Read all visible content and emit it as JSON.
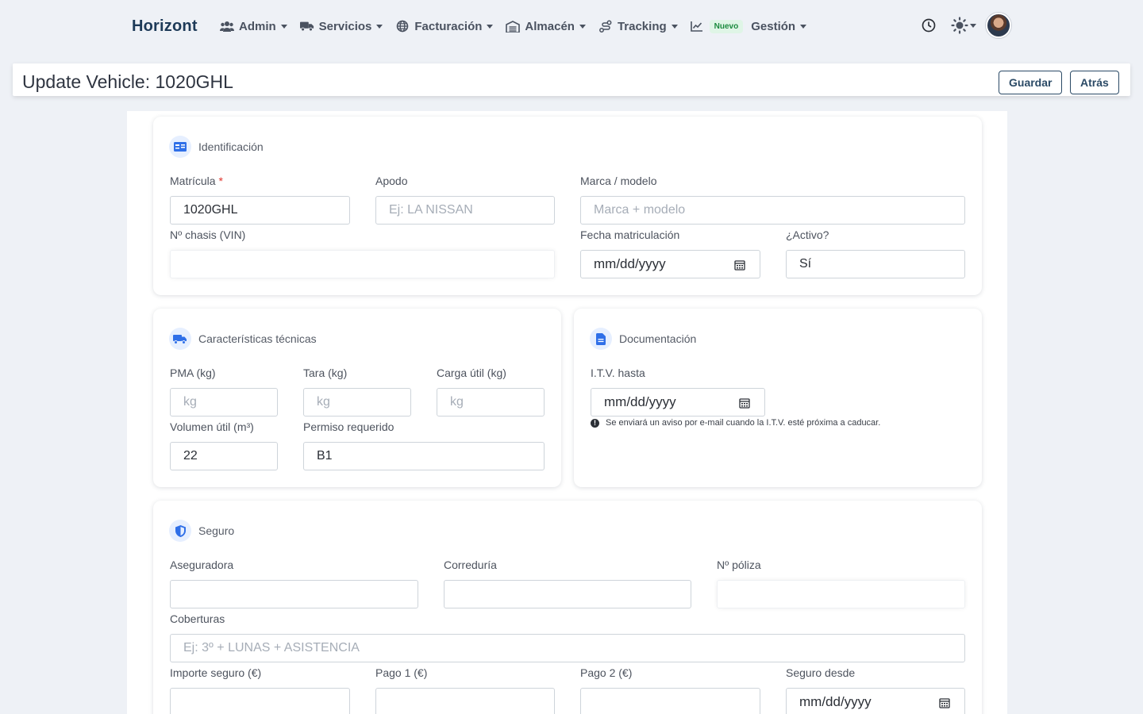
{
  "nav": {
    "brand": "Horizont",
    "items": [
      {
        "label": "Admin",
        "icon": "users-icon"
      },
      {
        "label": "Servicios",
        "icon": "truck-icon"
      },
      {
        "label": "Facturación",
        "icon": "globe-icon"
      },
      {
        "label": "Almacén",
        "icon": "warehouse-icon"
      },
      {
        "label": "Tracking",
        "icon": "route-icon"
      }
    ],
    "badge": "Nuevo",
    "gestion": "Gestión"
  },
  "header": {
    "title": "Update Vehicle: 1020GHL",
    "save": "Guardar",
    "back": "Atrás"
  },
  "identificacion": {
    "title": "Identificación",
    "matricula_label": "Matrícula",
    "matricula_required": "*",
    "matricula_value": "1020GHL",
    "apodo_label": "Apodo",
    "apodo_placeholder": "Ej: LA NISSAN",
    "marca_label": "Marca / modelo",
    "marca_placeholder": "Marca + modelo",
    "chasis_label": "Nº chasis (VIN)",
    "fecha_label": "Fecha matriculación",
    "fecha_value": "mm/dd/yyyy",
    "activo_label": "¿Activo?",
    "activo_value": "Sí"
  },
  "tecnicas": {
    "title": "Características técnicas",
    "pma_label": "PMA (kg)",
    "tara_label": "Tara (kg)",
    "carga_label": "Carga útil (kg)",
    "kg_placeholder": "kg",
    "volumen_label": "Volumen útil (m³)",
    "volumen_value": "22",
    "permiso_label": "Permiso requerido",
    "permiso_value": "B1"
  },
  "documentacion": {
    "title": "Documentación",
    "itv_label": "I.T.V. hasta",
    "itv_value": "mm/dd/yyyy",
    "hint": "Se enviará un aviso por e-mail cuando la I.T.V. esté próxima a caducar."
  },
  "seguro": {
    "title": "Seguro",
    "aseguradora_label": "Aseguradora",
    "correduria_label": "Correduría",
    "poliza_label": "Nº póliza",
    "coberturas_label": "Coberturas",
    "coberturas_placeholder": "Ej: 3º + LUNAS + ASISTENCIA",
    "importe_label": "Importe seguro (€)",
    "pago1_label": "Pago 1 (€)",
    "pago2_label": "Pago 2 (€)",
    "desde_label": "Seguro desde",
    "desde_value": "mm/dd/yyyy"
  }
}
